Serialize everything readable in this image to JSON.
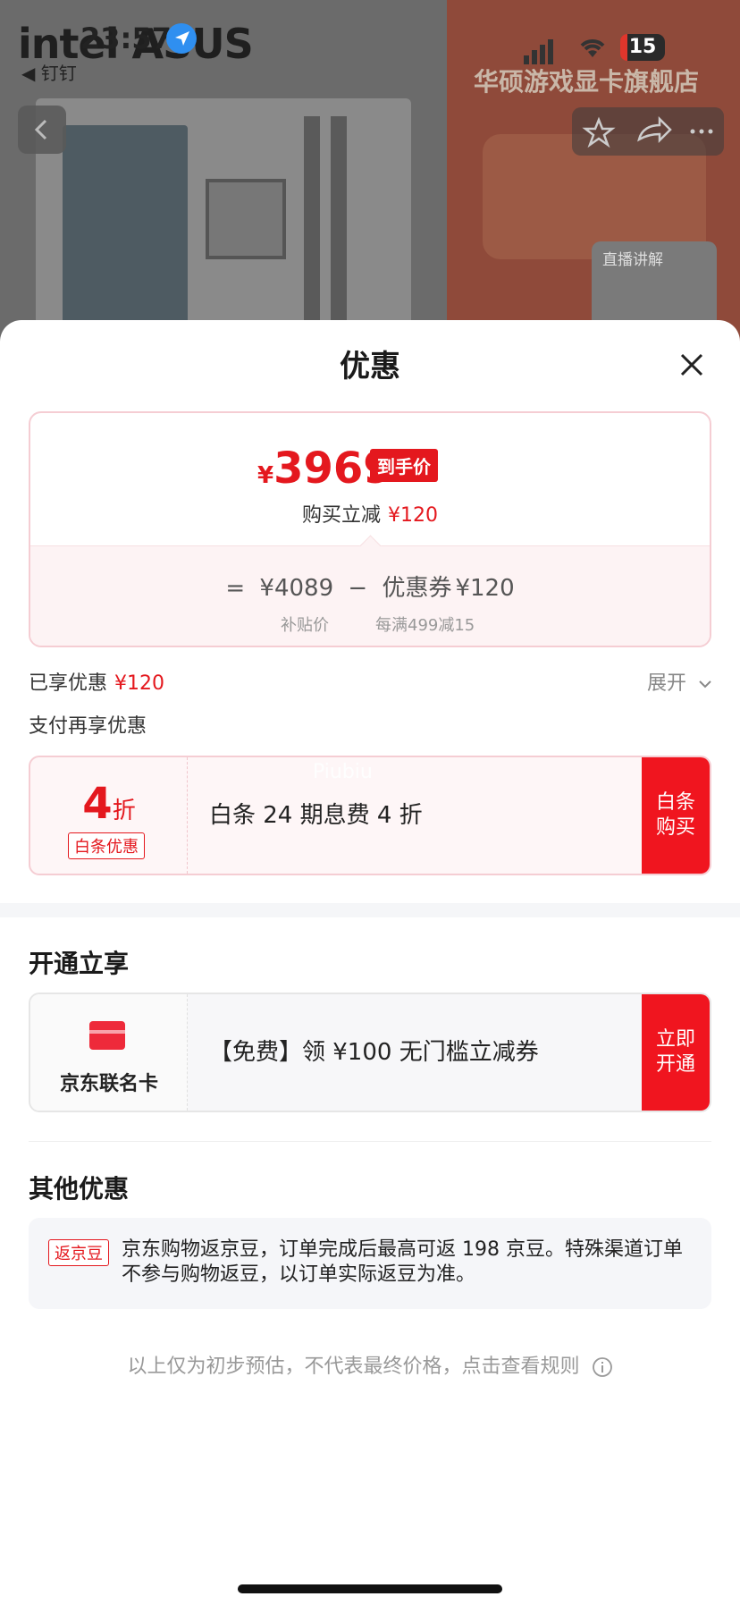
{
  "status_bar": {
    "time": "23:57",
    "back_app": "◀ 钉钉",
    "battery": "15"
  },
  "background": {
    "brand": "intel ASUS",
    "store_title": "华硕游戏显卡旗舰店",
    "live_label": "直播讲解"
  },
  "sheet": {
    "title": "优惠",
    "close_icon": "close-icon"
  },
  "price_card": {
    "currency": "¥",
    "final_price": "3969",
    "final_tag": "到手价",
    "reduce_label": "购买立减",
    "reduce_value": "¥120",
    "equals": "=",
    "base_price": "¥4089",
    "minus": "−",
    "coupon_label": "优惠券",
    "coupon_value": "¥120",
    "base_label": "补贴价",
    "coupon_rule": "每满499减15"
  },
  "enjoyed": {
    "label": "已享优惠",
    "value": "¥120",
    "expand": "展开"
  },
  "pay_section": {
    "title": "支付再享优惠",
    "watermark": "Piubiu",
    "discount_value": "4",
    "discount_unit": "折",
    "badge": "白条优惠",
    "desc": "白条 24 期息费 4 折",
    "cta": "白条购买"
  },
  "open_section": {
    "title": "开通立享",
    "card_name": "京东联名卡",
    "desc": "【免费】领 ¥100 无门槛立减券",
    "cta": "立即开通"
  },
  "other_section": {
    "title": "其他优惠",
    "tag": "返京豆",
    "text": "京东购物返京豆，订单完成后最高可返 198 京豆。特殊渠道订单不参与购物返豆，以订单实际返豆为准。"
  },
  "disclaimer": "以上仅为初步预估，不代表最终价格，点击查看规则",
  "colors": {
    "accent": "#e4181e",
    "cta": "#f0151f"
  }
}
